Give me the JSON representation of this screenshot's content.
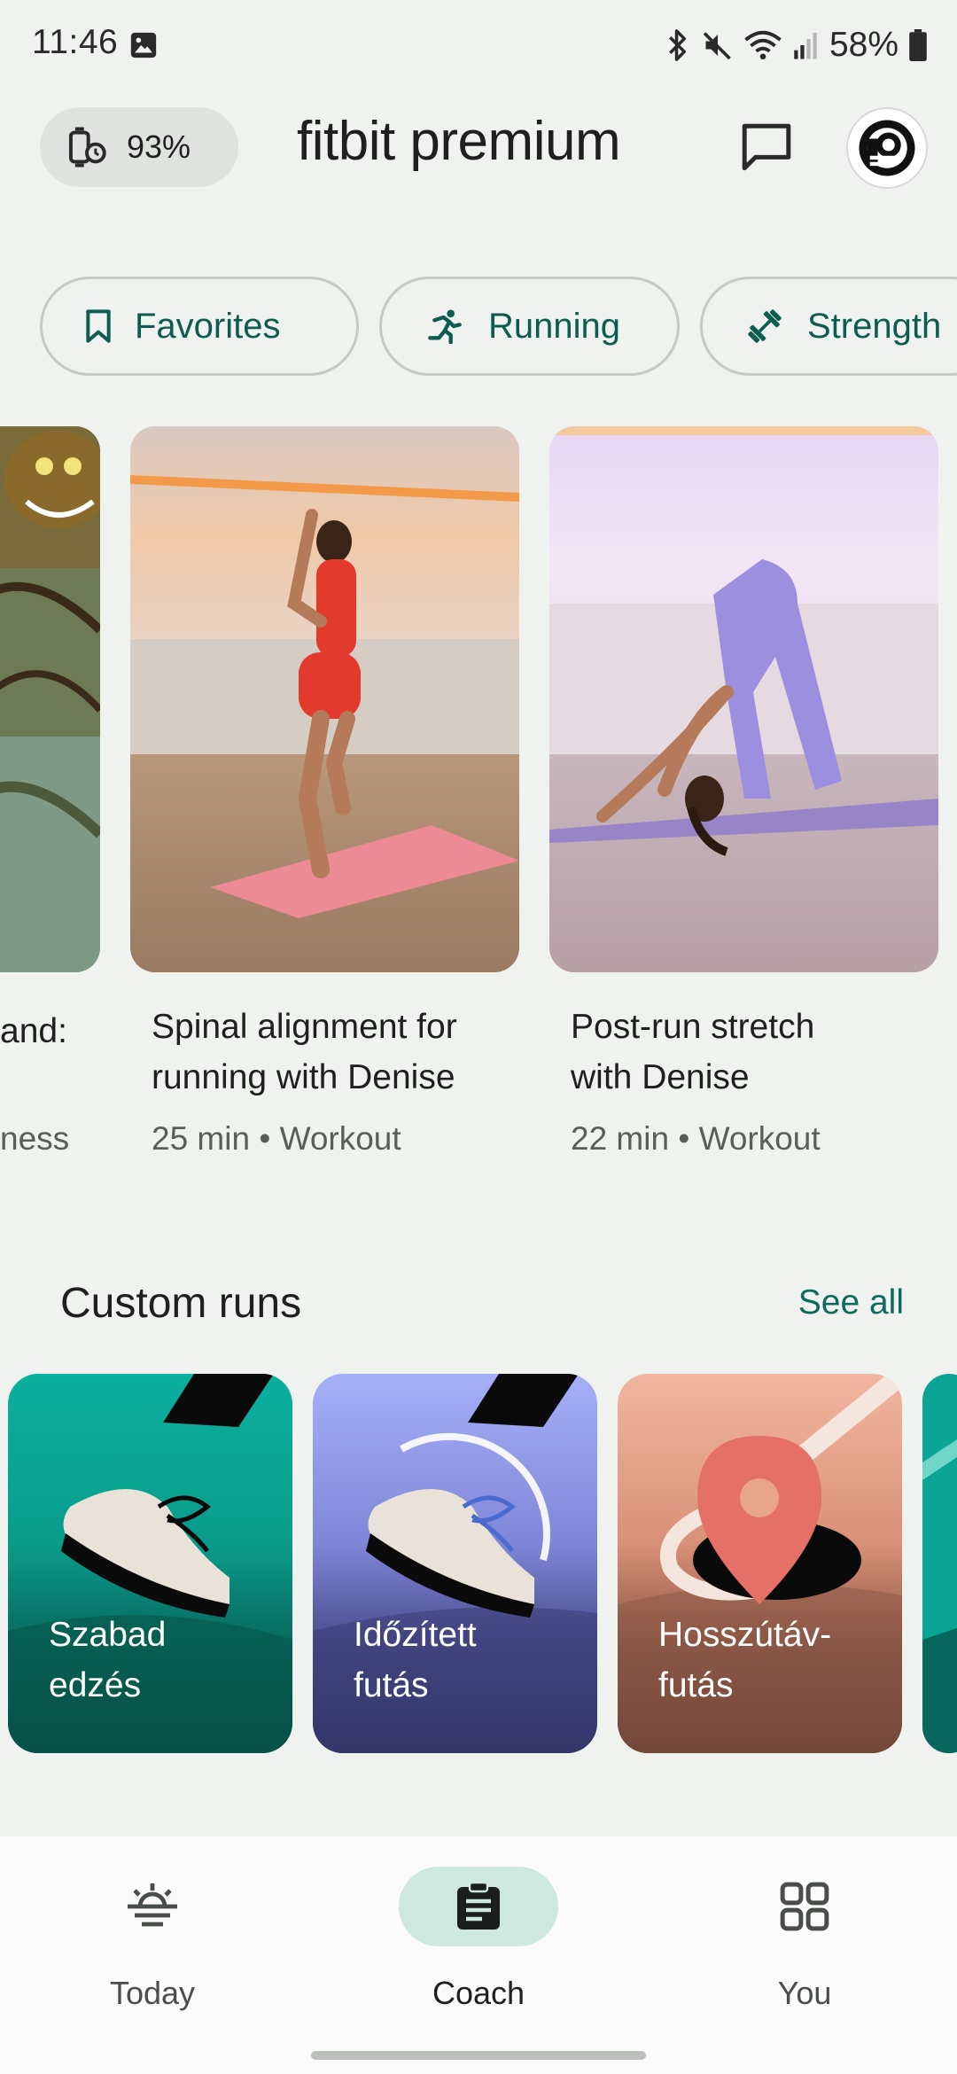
{
  "status_bar": {
    "time": "11:46",
    "battery": "58%"
  },
  "header": {
    "device_battery": "93%",
    "title": "fitbit premium"
  },
  "chips": [
    {
      "label": "Favorites",
      "icon": "bookmark-icon"
    },
    {
      "label": "Running",
      "icon": "running-icon"
    },
    {
      "label": "Strength",
      "icon": "dumbbell-icon"
    }
  ],
  "workouts": [
    {
      "title_line1": "and:",
      "meta": "ness"
    },
    {
      "title_line1": "Spinal alignment for",
      "title_line2": "running with Denise",
      "duration": "25 min",
      "type": "Workout",
      "meta": "25 min • Workout"
    },
    {
      "title_line1": "Post-run stretch",
      "title_line2": "with Denise",
      "duration": "22 min",
      "type": "Workout",
      "meta": "22 min • Workout"
    }
  ],
  "custom_runs": {
    "title": "Custom runs",
    "see_all": "See all",
    "items": [
      {
        "line1": "Szabad",
        "line2": "edzés",
        "color": "#0aa594"
      },
      {
        "line1": "Időzített",
        "line2": "futás",
        "color": "#8e96f0"
      },
      {
        "line1": "Hosszútáv-",
        "line2": "futás",
        "color": "#e9a58a"
      }
    ]
  },
  "bottom_nav": {
    "items": [
      {
        "label": "Today",
        "icon": "sunrise-icon"
      },
      {
        "label": "Coach",
        "icon": "clipboard-icon",
        "active": true
      },
      {
        "label": "You",
        "icon": "grid-icon"
      }
    ]
  }
}
